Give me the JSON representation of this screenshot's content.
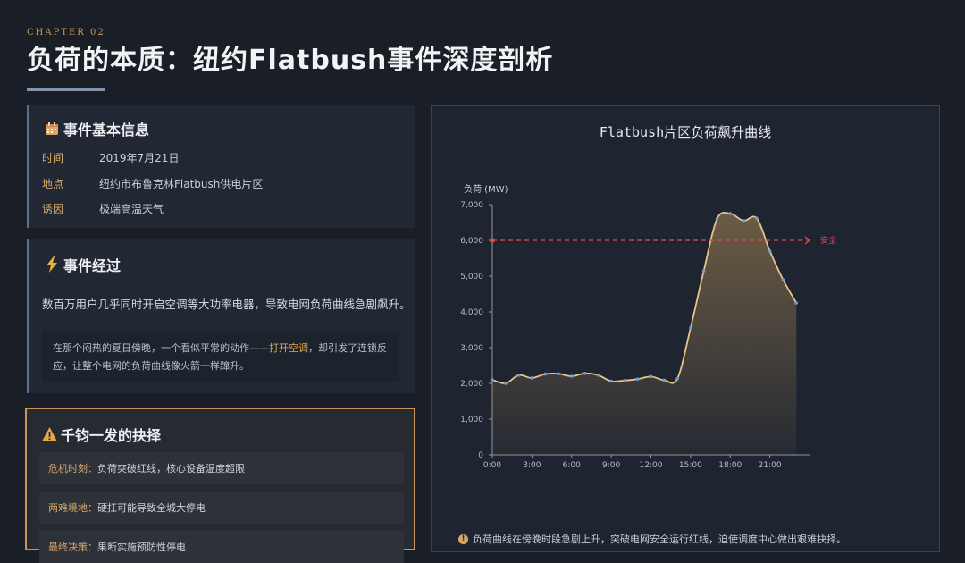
{
  "header": {
    "chapter": "CHAPTER 02",
    "title": "负荷的本质：纽约Flatbush事件深度剖析"
  },
  "info": {
    "heading": "事件基本信息",
    "icon": "calendar-icon",
    "rows": [
      {
        "k": "时间",
        "v": "2019年7月21日"
      },
      {
        "k": "地点",
        "v": "纽约市布鲁克林Flatbush供电片区"
      },
      {
        "k": "诱因",
        "v": "极端高温天气"
      }
    ]
  },
  "story": {
    "heading": "事件经过",
    "icon": "lightning-icon",
    "text": "数百万用户几乎同时开启空调等大功率电器，导致电网负荷曲线急剧飙升。",
    "quote_a": "在那个闷热的夏日傍晚，一个看似平常的动作——",
    "quote_hl": "打开空调",
    "quote_b": "，却引发了连锁反应，让整个电网的负荷曲线像火箭一样蹿升。"
  },
  "choice": {
    "heading": "千钧一发的抉择",
    "icon": "warning-icon",
    "options": [
      {
        "k": "危机时刻：",
        "v": "负荷突破红线，核心设备温度超限"
      },
      {
        "k": "两难境地：",
        "v": "硬扛可能导致全城大停电"
      },
      {
        "k": "最终决策：",
        "v": "果断实施预防性停电"
      }
    ]
  },
  "chart_note": "负荷曲线在傍晚时段急剧上升，突破电网安全运行红线，迫使调度中心做出艰难抉择。",
  "chart_data": {
    "type": "area",
    "title": "Flatbush片区负荷飙升曲线",
    "ylabel": "负荷 (MW)",
    "xlabel": "",
    "ylim": [
      0,
      7000
    ],
    "yticks": [
      0,
      1000,
      2000,
      3000,
      4000,
      5000,
      6000,
      7000
    ],
    "ytick_labels": [
      "0",
      "1,000",
      "2,000",
      "3,000",
      "4,000",
      "5,000",
      "6,000",
      "7,000"
    ],
    "xlim": [
      0,
      24
    ],
    "xticks": [
      0,
      3,
      6,
      9,
      12,
      15,
      18,
      21
    ],
    "xtick_labels": [
      "0:00",
      "3:00",
      "6:00",
      "9:00",
      "12:00",
      "15:00",
      "18:00",
      "21:00"
    ],
    "x": [
      0,
      1,
      2,
      3,
      4,
      5,
      6,
      7,
      8,
      9,
      10,
      11,
      12,
      13,
      14,
      15,
      16,
      17,
      18,
      19,
      20,
      21,
      22,
      23
    ],
    "values": [
      2100,
      2000,
      2230,
      2150,
      2260,
      2270,
      2200,
      2280,
      2230,
      2060,
      2080,
      2120,
      2190,
      2090,
      2130,
      3550,
      5150,
      6600,
      6750,
      6550,
      6620,
      5700,
      4900,
      4250
    ],
    "threshold": {
      "value": 6000,
      "label": "安全"
    },
    "grid": false,
    "colors": {
      "line": "#e8c38a",
      "fill": "#b8935a",
      "threshold": "#e0484e",
      "marker": "#6f9cd8"
    }
  }
}
